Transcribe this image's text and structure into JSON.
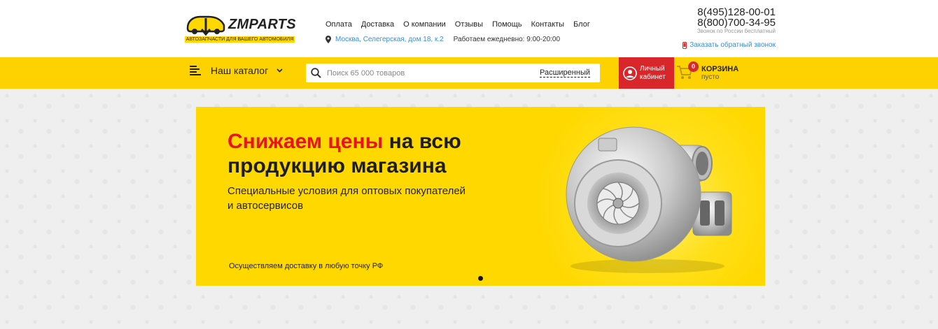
{
  "header": {
    "logo": {
      "name": "ZMPARTS",
      "tagline": "АВТОЗАПЧАСТИ ДЛЯ ВАШЕГО АВТОМОБИЛЯ",
      "brand_color": "#ffd800"
    },
    "nav": [
      "Оплата",
      "Доставка",
      "О компании",
      "Отзывы",
      "Помощь",
      "Контакты",
      "Блог"
    ],
    "address": "Москва, Селегерская, дом 18, к.2",
    "hours": "Работаем ежедневно: 9:00-20:00",
    "phone_1": "8(495)128-00-01",
    "phone_2": "8(800)700-34-95",
    "phone_note": "Звонок по России бесплатный",
    "callback": "Заказать обратный звонок",
    "link_color": "#3a8ed8"
  },
  "toolbar": {
    "catalog_label": "Наш каталог",
    "search_placeholder": "Поиск 65 000 товаров",
    "search_advanced": "Расширенный",
    "cabinet_line1": "Личный",
    "cabinet_line2": "кабинет",
    "cart_title": "КОРЗИНА",
    "cart_status": "пусто",
    "cart_count": "0",
    "bar_color": "#fdd200",
    "accent_red": "#d8262a"
  },
  "banner": {
    "headline_red": "Снижаем цены",
    "headline_rest_1": " на всю",
    "headline_line2": "продукцию магазина",
    "sub_line1": "Специальные условия для оптовых покупателей",
    "sub_line2": "и автосервисов",
    "delivery": "Осуществляем доставку в любую точку РФ",
    "background": "#ffd800",
    "image": "turbocharger"
  }
}
